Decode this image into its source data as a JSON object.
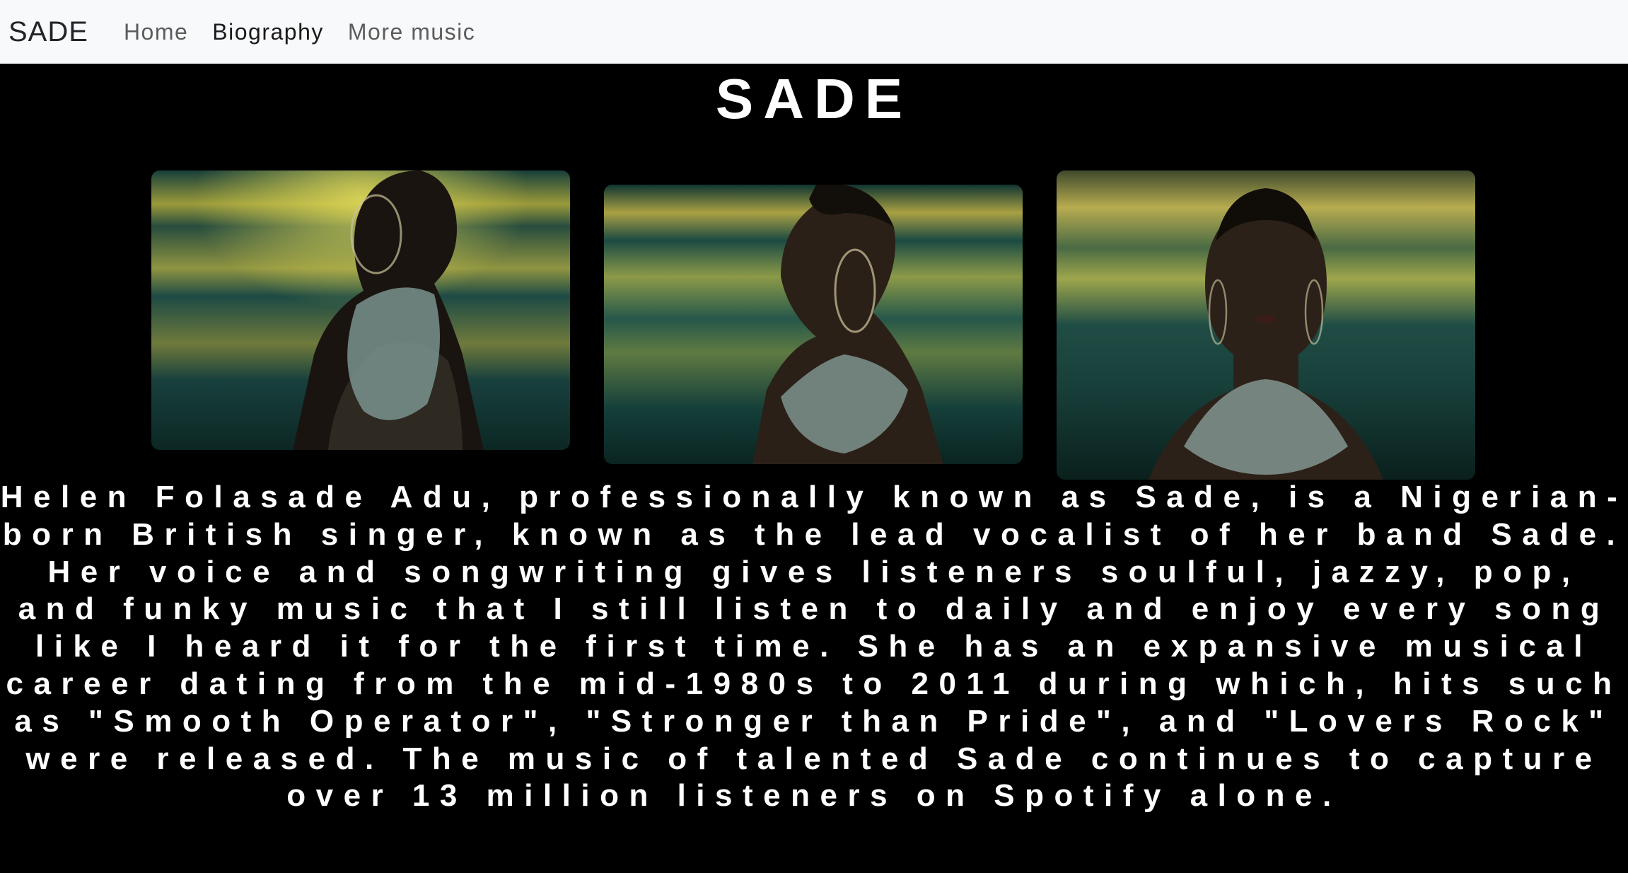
{
  "navbar": {
    "brand": "SADE",
    "links": [
      {
        "label": "Home",
        "active": false
      },
      {
        "label": "Biography",
        "active": true
      },
      {
        "label": "More music",
        "active": false
      }
    ]
  },
  "main": {
    "title": "SADE",
    "bio": "Helen Folasade Adu, professionally known as Sade, is a Nigerian-born British singer, known as the lead vocalist of her band Sade. Her voice and songwriting gives listeners soulful, jazzy, pop, and funky music that I still listen to daily and enjoy every song like I heard it for the first time. She has an expansive musical career dating from the mid-1980s to 2011 during which, hits such as \"Smooth Operator\", \"Stronger than Pride\", and \"Lovers Rock\" were released. The music of talented Sade continues to capture over 13 million listeners on Spotify alone."
  },
  "colors": {
    "navbar_bg": "#f8f9fa",
    "page_bg": "#000000",
    "text": "#ffffff",
    "photo_teal": "#0d3a34",
    "photo_gold": "#c9c24a"
  }
}
